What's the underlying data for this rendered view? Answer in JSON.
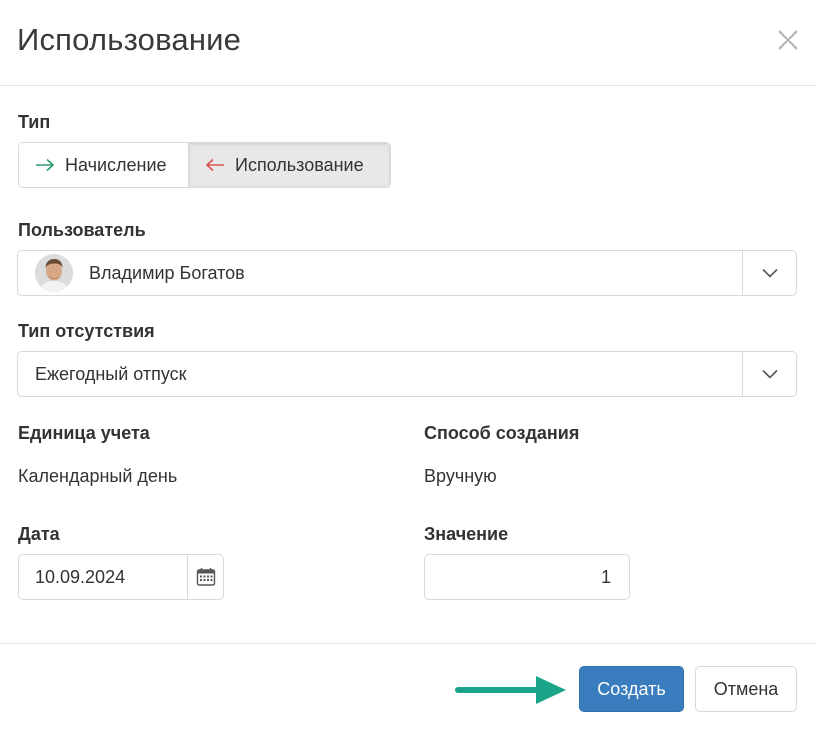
{
  "dialog": {
    "title": "Использование"
  },
  "type_field": {
    "label": "Тип",
    "options": [
      {
        "label": "Начисление",
        "icon": "arrow-right-icon",
        "color": "#2e9a6e"
      },
      {
        "label": "Использование",
        "icon": "arrow-left-icon",
        "color": "#d9534f"
      }
    ],
    "selected": "Использование"
  },
  "user_field": {
    "label": "Пользователь",
    "value": "Владимир Богатов"
  },
  "absence_type_field": {
    "label": "Тип отсутствия",
    "value": "Ежегодный отпуск"
  },
  "unit_field": {
    "label": "Единица учета",
    "value": "Календарный день"
  },
  "creation_method_field": {
    "label": "Способ создания",
    "value": "Вручную"
  },
  "date_field": {
    "label": "Дата",
    "value": "10.09.2024"
  },
  "amount_field": {
    "label": "Значение",
    "value": "1"
  },
  "footer": {
    "create_label": "Создать",
    "cancel_label": "Отмена"
  },
  "colors": {
    "primary": "#3a7dbf",
    "accent_arrow": "#1aa58a",
    "accrual_arrow": "#2e9a6e",
    "usage_arrow": "#d9534f"
  }
}
